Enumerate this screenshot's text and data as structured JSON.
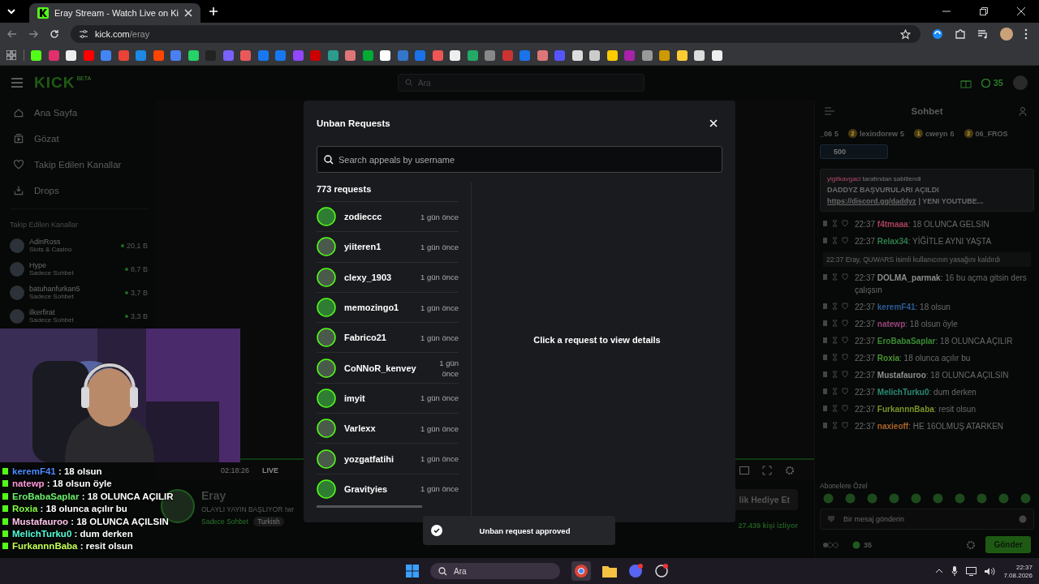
{
  "browser": {
    "tab_title": "Eray Stream - Watch Live on Ki",
    "url_host": "kick.com",
    "url_path": "/eray"
  },
  "site": {
    "logo": "KICK",
    "logo_badge": "BETA",
    "search_placeholder": "Ara",
    "coins": "35"
  },
  "sidebar": {
    "nav": [
      {
        "kind": "home",
        "label": "Ana Sayfa"
      },
      {
        "kind": "browse",
        "label": "Gözat"
      },
      {
        "kind": "heart",
        "label": "Takip Edilen Kanallar"
      },
      {
        "kind": "drops",
        "label": "Drops"
      }
    ],
    "section_title": "Takip Edilen Kanallar",
    "channels": [
      {
        "name": "AdinRoss",
        "category": "Slots & Casino",
        "viewers": "20,1 B"
      },
      {
        "name": "Hype",
        "category": "Sadece Sohbet",
        "viewers": "8,7 B"
      },
      {
        "name": "batuhanfurkan5",
        "category": "Sadece Sohbet",
        "viewers": "3,7 B"
      },
      {
        "name": "ilkerfirat",
        "category": "Sadece Sohbet",
        "viewers": "3,3 B"
      }
    ]
  },
  "player": {
    "live": "LIVE",
    "time": "02:18:26"
  },
  "stream_info": {
    "streamer": "Eray",
    "title": "OLAYLI YAYIN BAŞLIYOR !wr",
    "tags": [
      "Sadece Sohbet",
      "Turkish"
    ],
    "viewers": "27.439 kişi izliyor",
    "gift_button": "lik Hediye Et"
  },
  "chat": {
    "title": "Sohbet",
    "leaders": [
      {
        "name": "_06",
        "count": "5"
      },
      {
        "rank": "2",
        "name": "lexindorew",
        "count": "5"
      },
      {
        "rank": "1",
        "name": "cweyn",
        "count": "6"
      },
      {
        "rank": "2",
        "name": "06_FROS"
      }
    ],
    "goal": "500",
    "pinned": {
      "by": "yigitkavgaci",
      "by_suffix": "tarafından sabitlendi",
      "text": "DADDYZ BAŞVURULARI AÇILDI",
      "link": "https://discord.gg/daddyz",
      "rest": "| YENI YOUTUBE..."
    },
    "messages": [
      {
        "kind": "user",
        "time": "22:37",
        "user": "f4tmaaa",
        "color": "#a8405c",
        "text": ": 18 OLUNCA GELSIN"
      },
      {
        "kind": "user",
        "time": "22:37",
        "user": "Relax34",
        "color": "#2e7d4a",
        "text": ": YİĞİTLE AYNI YAŞTA"
      },
      {
        "kind": "system",
        "time": "22:37",
        "text": "Eray, QUWARS isimli kullanıcının yasağını kaldırdı"
      },
      {
        "kind": "user",
        "time": "22:37",
        "user": "DOLMA_parmak",
        "color": "#8c8c8c",
        "text": ": 16 bu açma gitsin ders çalışsın"
      },
      {
        "kind": "user",
        "time": "22:37",
        "user": "keremF41",
        "color": "#2d5a94",
        "text": ": 18 olsun"
      },
      {
        "kind": "user",
        "time": "22:37",
        "user": "natewp",
        "color": "#96467a",
        "text": ": 18 olsun öyle"
      },
      {
        "kind": "user",
        "time": "22:37",
        "user": "EroBabaSaplar",
        "color": "#3b8a34",
        "text": ": 18 OLUNCA AÇILIR"
      },
      {
        "kind": "user",
        "time": "22:37",
        "user": "Roxia",
        "color": "#4a9432",
        "text": ": 18 olunca açılır bu"
      },
      {
        "kind": "user",
        "time": "22:37",
        "user": "Mustafauroo",
        "color": "#8e8e8e",
        "text": ": 18 OLUNCA AÇILSIN"
      },
      {
        "kind": "user",
        "time": "22:37",
        "user": "MelichTurku0",
        "color": "#2a8a74",
        "text": ": dum derken"
      },
      {
        "kind": "user",
        "time": "22:37",
        "user": "FurkannnBaba",
        "color": "#7a9428",
        "text": ": resit olsun"
      },
      {
        "kind": "user",
        "time": "22:37",
        "user": "naxieoff",
        "color": "#a8642a",
        "text": ": HE 16OLMUŞ ATARKEN"
      }
    ],
    "emote_label": "Abonelere Özel",
    "input_placeholder": "Bir mesaj gönderin",
    "points": "35",
    "send_button": "Gönder"
  },
  "modal": {
    "title": "Unban Requests",
    "search_placeholder": "Search appeals by username",
    "count": "773 requests",
    "requests": [
      {
        "name": "zodieccc",
        "age": "1 gün önce"
      },
      {
        "name": "yiiteren1",
        "age": "1 gün önce"
      },
      {
        "name": "clexy_1903",
        "age": "1 gün önce"
      },
      {
        "name": "memozingo1",
        "age": "1 gün önce"
      },
      {
        "name": "Fabrico21",
        "age": "1 gün önce"
      },
      {
        "name": "CoNNoR_kenvey",
        "age": "1 gün önce"
      },
      {
        "name": "imyit",
        "age": "1 gün önce"
      },
      {
        "name": "Varlexx",
        "age": "1 gün önce"
      },
      {
        "name": "yozgatfatihi",
        "age": "1 gün önce"
      },
      {
        "name": "Gravityies",
        "age": "1 gün önce"
      }
    ],
    "empty_text": "Click a request to view details"
  },
  "toast": {
    "text": "Unban request approved"
  },
  "overlay_chat": [
    {
      "user": "keremF41",
      "color": "#4a8cff",
      "text": ": 18 olsun"
    },
    {
      "user": "natewp",
      "color": "#ff9ad8",
      "text": ": 18 olsun öyle"
    },
    {
      "user": "EroBabaSaplar",
      "color": "#6cf06c",
      "text": ": 18 OLUNCA AÇILIR"
    },
    {
      "user": "Roxia",
      "color": "#88ff44",
      "text": ": 18 olunca açılır bu"
    },
    {
      "user": "Mustafauroo",
      "color": "#ffc4e8",
      "text": ": 18 OLUNCA AÇILSIN"
    },
    {
      "user": "MelichTurku0",
      "color": "#55ffd8",
      "text": ": dum derken"
    },
    {
      "user": "FurkannnBaba",
      "color": "#c4ff55",
      "text": ": resit olsun"
    }
  ],
  "taskbar": {
    "search_placeholder": "Ara",
    "time": "22:37",
    "date": "7.08.2026"
  }
}
